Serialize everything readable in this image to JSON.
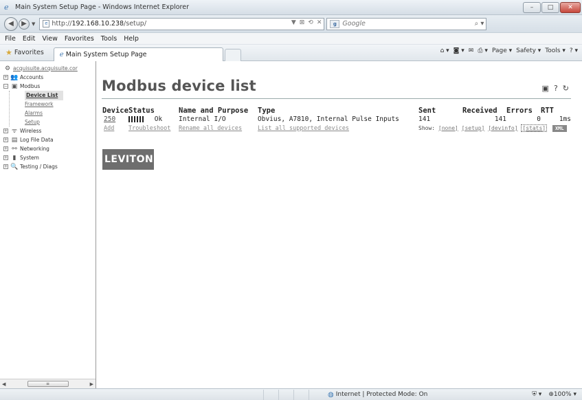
{
  "window": {
    "title": "Main System Setup Page - Windows Internet Explorer",
    "min": "–",
    "max": "□",
    "close": "✕"
  },
  "address": {
    "url_prefix": "http://",
    "url_host": "192.168.10.238",
    "url_path": "/setup/",
    "search_placeholder": "Google"
  },
  "menu": [
    "File",
    "Edit",
    "View",
    "Favorites",
    "Tools",
    "Help"
  ],
  "favbar": {
    "favorites_label": "Favorites",
    "tab_label": "Main System Setup Page",
    "commands": [
      "Page ▾",
      "Safety ▾",
      "Tools ▾"
    ]
  },
  "sidebar": {
    "host": "acquisuite.acquisuite.cor",
    "items": [
      {
        "label": "Accounts"
      },
      {
        "label": "Modbus"
      },
      {
        "label": "Device List"
      },
      {
        "label": "Framework"
      },
      {
        "label": "Alarms"
      },
      {
        "label": "Setup"
      },
      {
        "label": "Wireless"
      },
      {
        "label": "Log File Data"
      },
      {
        "label": "Networking"
      },
      {
        "label": "System"
      },
      {
        "label": "Testing / Diags"
      }
    ]
  },
  "main": {
    "title": "Modbus device list",
    "columns": [
      "Device",
      "Status",
      "Name and Purpose",
      "Type",
      "Sent",
      "Received",
      "Errors",
      "RTT"
    ],
    "row": {
      "device": "250",
      "status": "Ok",
      "name": "Internal I/O",
      "type": "Obvius, A7810, Internal Pulse Inputs",
      "sent": "141",
      "received": "141",
      "errors": "0",
      "rtt": "1ms"
    },
    "actions": {
      "add": "Add",
      "troubleshoot": "Troubleshoot",
      "rename": "Rename all devices",
      "list_supported": "List all supported devices",
      "show_label": "Show:",
      "show_none": "[none]",
      "show_setup": "[setup]",
      "show_devinfo": "[devinfo]",
      "show_stats": "[stats]",
      "xml": "XML"
    },
    "logo": "LEVITON"
  },
  "statusbar": {
    "zone": "Internet | Protected Mode: On",
    "zoom": "100%"
  }
}
